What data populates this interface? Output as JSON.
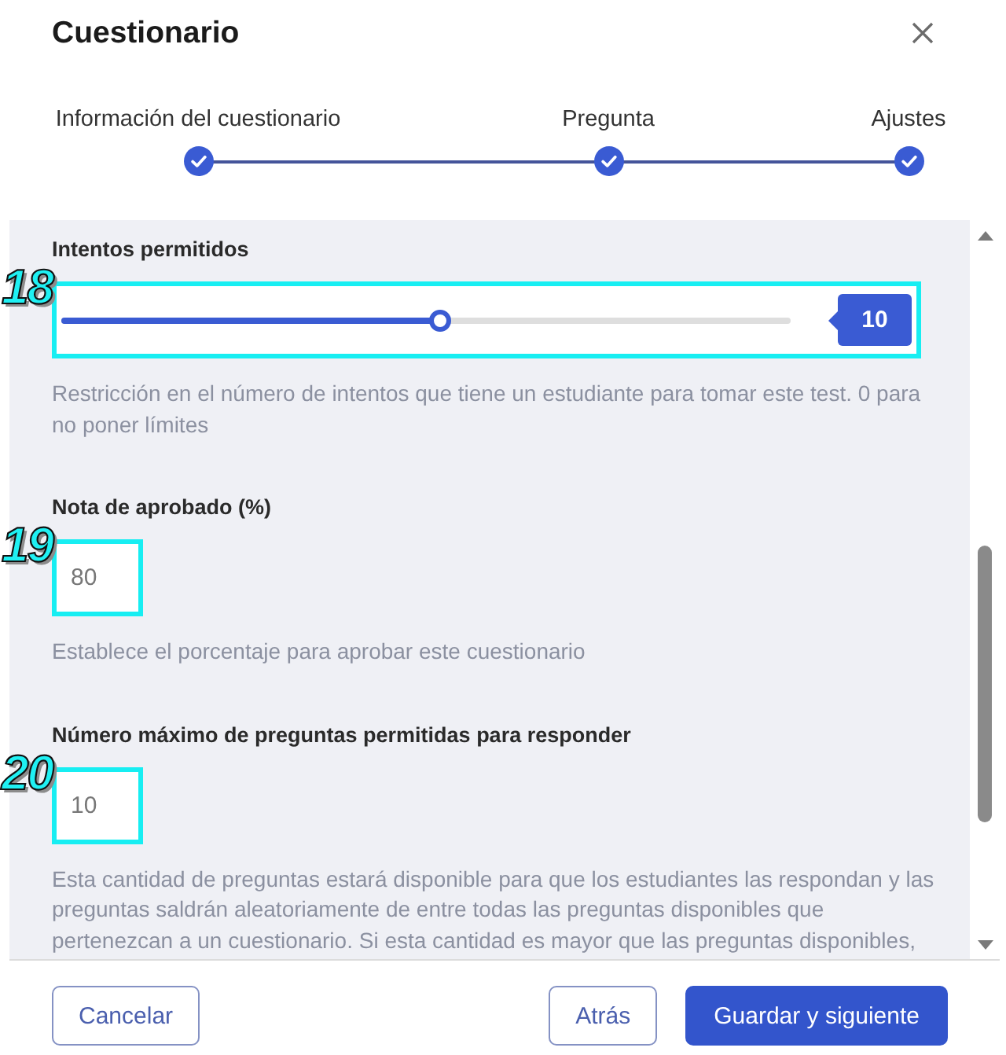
{
  "dialog": {
    "title": "Cuestionario"
  },
  "steps": [
    {
      "label": "Información del cuestionario",
      "completed": true
    },
    {
      "label": "Pregunta",
      "completed": true
    },
    {
      "label": "Ajustes",
      "completed": true
    }
  ],
  "settings": [
    {
      "kind": "slider",
      "label": "Intentos permitidos",
      "level": 0.52,
      "value": "10",
      "help": "Restricción en el número de intentos que tiene un estudiante para tomar este test. 0 para no poner límites",
      "callout": "18"
    },
    {
      "kind": "input",
      "label": "Nota de aprobado (%)",
      "value": "80",
      "help": "Establece el porcentaje para aprobar este cuestionario",
      "callout": "19"
    },
    {
      "kind": "input",
      "label": "Número máximo de preguntas permitidas para responder",
      "value": "10",
      "help": "Esta cantidad de preguntas estará disponible para que los estudiantes las respondan y las preguntas saldrán aleatoriamente de entre todas las preguntas disponibles que pertenezcan a un cuestionario. Si esta cantidad es mayor que las preguntas disponibles,",
      "callout": "20"
    }
  ],
  "footer": {
    "left": [
      {
        "label": "Cancelar",
        "kind": "outline"
      }
    ],
    "right": [
      {
        "label": "Atrás",
        "kind": "outline"
      },
      {
        "label": "Guardar y siguiente",
        "kind": "primary"
      }
    ]
  }
}
